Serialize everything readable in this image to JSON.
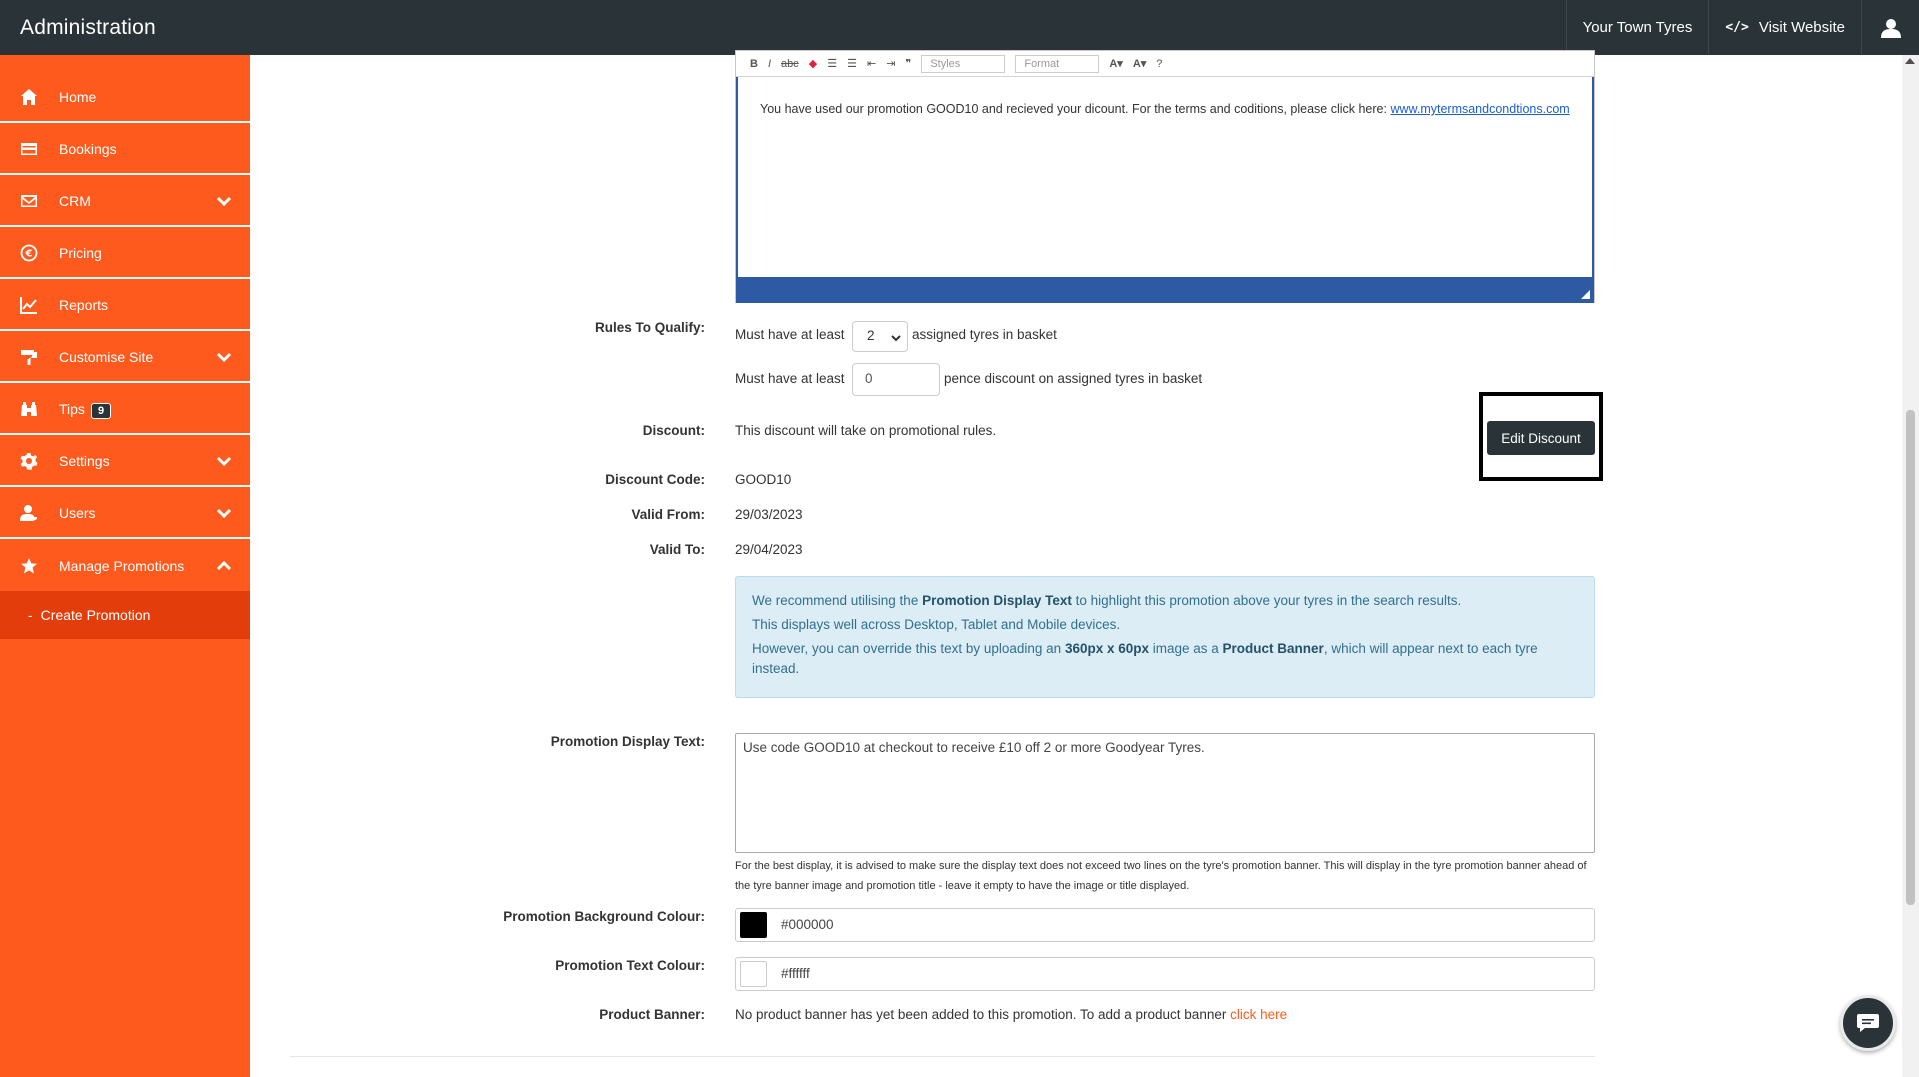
{
  "app_title": "Administration",
  "topbar": {
    "shop_name": "Your Town Tyres",
    "visit_icon_text": "</>",
    "visit_label": "Visit Website"
  },
  "sidebar": {
    "items": [
      {
        "label": "Home",
        "icon": "home-icon"
      },
      {
        "label": "Bookings",
        "icon": "card-icon"
      },
      {
        "label": "CRM",
        "icon": "envelope-icon",
        "expandable": true
      },
      {
        "label": "Pricing",
        "icon": "euro-icon"
      },
      {
        "label": "Reports",
        "icon": "chart-icon"
      },
      {
        "label": "Customise Site",
        "icon": "paint-roller-icon",
        "expandable": true
      },
      {
        "label": "Tips",
        "icon": "binoculars-icon",
        "badge": "9"
      },
      {
        "label": "Settings",
        "icon": "gear-icon",
        "expandable": true
      },
      {
        "label": "Users",
        "icon": "users-icon",
        "expandable": true
      },
      {
        "label": "Manage Promotions",
        "icon": "star-icon",
        "expanded": true
      }
    ],
    "sub_items": [
      {
        "label": "Create Promotion"
      }
    ]
  },
  "editor": {
    "toolbar": {
      "styles_label": "Styles",
      "format_label": "Format"
    },
    "body_text": "You have used our promotion GOOD10 and recieved your dicount. For the terms and coditions, please click here: ",
    "link_text": "www.mytermsandcondtions.com"
  },
  "rules": {
    "label": "Rules To Qualify:",
    "row1_prefix": "Must have at least",
    "row1_value": "2",
    "row1_suffix": "assigned tyres in basket",
    "row2_prefix": "Must have at least",
    "row2_value": "0",
    "row2_suffix": "pence discount on assigned tyres in basket"
  },
  "discount": {
    "label": "Discount:",
    "value": "This discount will take on promotional rules.",
    "edit_button": "Edit Discount"
  },
  "discount_code": {
    "label": "Discount Code:",
    "value": "GOOD10"
  },
  "valid_from": {
    "label": "Valid From:",
    "value": "29/03/2023"
  },
  "valid_to": {
    "label": "Valid To:",
    "value": "29/04/2023"
  },
  "info": {
    "line1_pre": "We recommend utilising the ",
    "line1_bold": "Promotion Display Text",
    "line1_post": " to highlight this promotion above your tyres in the search results.",
    "line2": "This displays well across Desktop, Tablet and Mobile devices.",
    "line3_pre": "However, you can override this text by uploading an ",
    "line3_bold1": "360px x 60px",
    "line3_mid": " image as a ",
    "line3_bold2": "Product Banner",
    "line3_post": ", which will appear next to each tyre instead."
  },
  "display_text": {
    "label": "Promotion Display Text:",
    "value": "Use code GOOD10 at checkout to receive £10 off 2 or more Goodyear Tyres.",
    "help": "For the best display, it is advised to make sure the display text does not exceed two lines on the tyre's promotion banner. This will display in the tyre promotion banner ahead of the tyre banner image and promotion title - leave it empty to have the image or title displayed."
  },
  "bg_colour": {
    "label": "Promotion Background Colour:",
    "value": "#000000",
    "swatch": "#000000"
  },
  "text_colour": {
    "label": "Promotion Text Colour:",
    "value": "#ffffff",
    "swatch": "#ffffff"
  },
  "product_banner": {
    "label": "Product Banner:",
    "text": "No product banner has yet been added to this promotion. To add a product banner ",
    "link": "click here"
  },
  "colors": {
    "sidebar": "#fe5a1d",
    "sidebar_sub": "#e23d0a",
    "topbar": "#2a3338",
    "editor_accent": "#2d5aa2"
  }
}
